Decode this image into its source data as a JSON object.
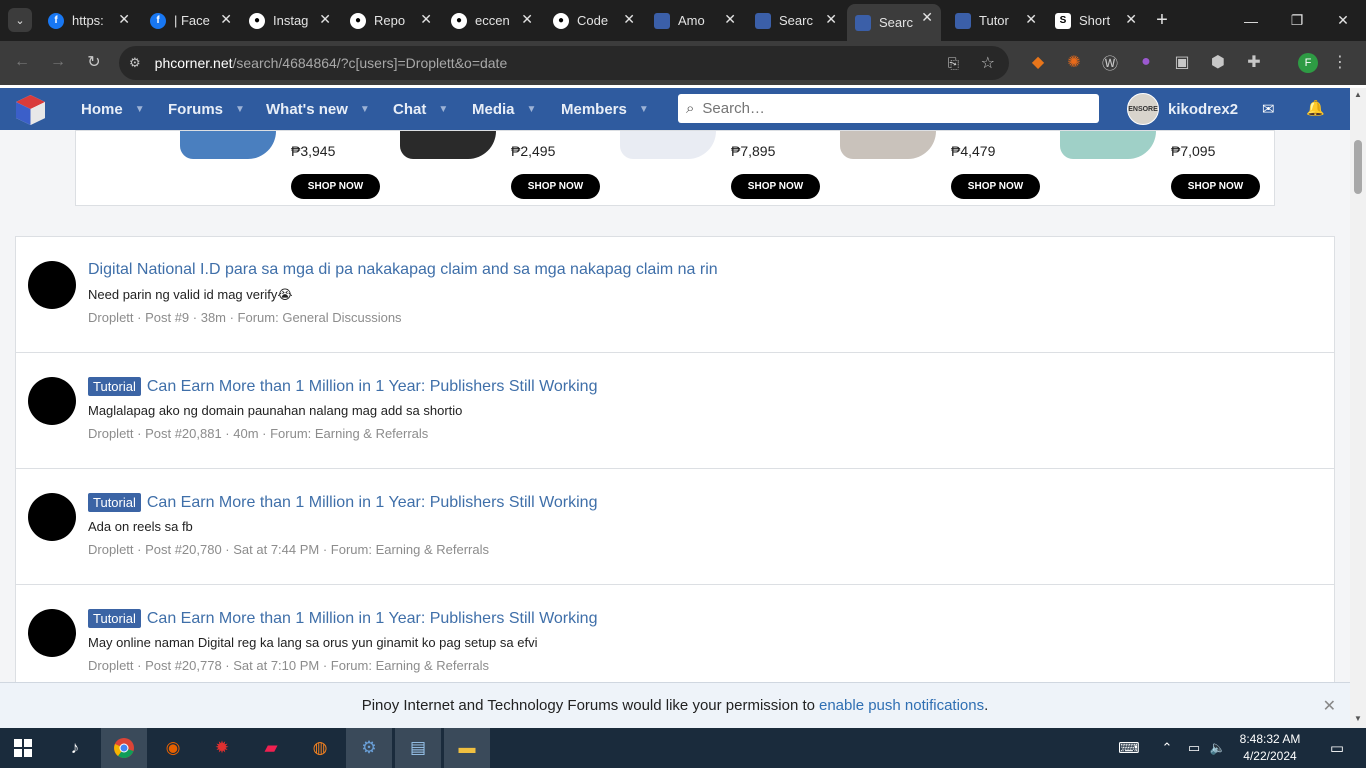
{
  "browser": {
    "tabs": [
      {
        "title": "https:",
        "favicon": "facebook-icon",
        "color": "#1877f2"
      },
      {
        "title": "| Face",
        "favicon": "facebook-icon",
        "color": "#1877f2"
      },
      {
        "title": "Instag",
        "favicon": "github-icon",
        "color": "#ffffff"
      },
      {
        "title": "Repo",
        "favicon": "github-icon",
        "color": "#ffffff"
      },
      {
        "title": "eccen",
        "favicon": "github-icon",
        "color": "#ffffff"
      },
      {
        "title": "Code",
        "favicon": "github-icon",
        "color": "#ffffff"
      },
      {
        "title": "Amo",
        "favicon": "phcorner-icon",
        "color": "#3b5fa8"
      },
      {
        "title": "Searc",
        "favicon": "phcorner-icon",
        "color": "#3b5fa8"
      },
      {
        "title": "Searc",
        "favicon": "phcorner-icon",
        "color": "#3b5fa8",
        "active": true
      },
      {
        "title": "Tutor",
        "favicon": "phcorner-icon",
        "color": "#3b5fa8"
      },
      {
        "title": "Short",
        "favicon": "shortio-icon",
        "color": "#ffffff"
      }
    ],
    "url_host": "phcorner.net",
    "url_path": "/search/4684864/?c[users]=Droplett&o=date",
    "profile_initial": "F"
  },
  "site": {
    "nav": {
      "home": "Home",
      "forums": "Forums",
      "whats_new": "What's new",
      "chat": "Chat",
      "media": "Media",
      "members": "Members"
    },
    "search_placeholder": "Search…",
    "username": "kikodrex2",
    "avatar_text": "ENSORE"
  },
  "ad": {
    "products": [
      {
        "price": "₱3,945",
        "button": "SHOP NOW",
        "shoe_color": "#4a7fbf"
      },
      {
        "price": "₱2,495",
        "button": "SHOP NOW",
        "shoe_color": "#2a2a2a"
      },
      {
        "price": "₱7,895",
        "button": "SHOP NOW",
        "shoe_color": "#e9ecf3"
      },
      {
        "price": "₱4,479",
        "button": "SHOP NOW",
        "shoe_color": "#c9c2bb"
      },
      {
        "price": "₱7,095",
        "button": "SHOP NOW",
        "shoe_color": "#9fd0c7"
      }
    ]
  },
  "results": [
    {
      "label": "",
      "title": "Digital National I.D para sa mga di pa nakakapag claim and sa mga nakapag claim na rin",
      "snippet": "Need parin ng valid id mag verify😭",
      "meta": "Droplett · Post #9 · 38m · Forum: General Discussions"
    },
    {
      "label": "Tutorial",
      "title": "Can Earn More than 1 Million in 1 Year: Publishers Still Working",
      "snippet": "Maglalapag ako ng domain paunahan nalang mag add sa shortio",
      "meta": "Droplett · Post #20,881 · 40m · Forum: Earning & Referrals"
    },
    {
      "label": "Tutorial",
      "title": "Can Earn More than 1 Million in 1 Year: Publishers Still Working",
      "snippet": "Ada on reels sa fb",
      "meta": "Droplett · Post #20,780 · Sat at 7:44 PM · Forum: Earning & Referrals"
    },
    {
      "label": "Tutorial",
      "title": "Can Earn More than 1 Million in 1 Year: Publishers Still Working",
      "snippet": "May online naman Digital reg ka lang sa orus yun ginamit ko pag setup sa efvi",
      "meta": "Droplett · Post #20,778 · Sat at 7:10 PM · Forum: Earning & Referrals"
    }
  ],
  "notification": {
    "text": "Pinoy Internet and Technology Forums would like your permission to",
    "link": "enable push notifications",
    "suffix": "."
  },
  "taskbar": {
    "time": "8:48:32 AM",
    "date": "4/22/2024"
  }
}
